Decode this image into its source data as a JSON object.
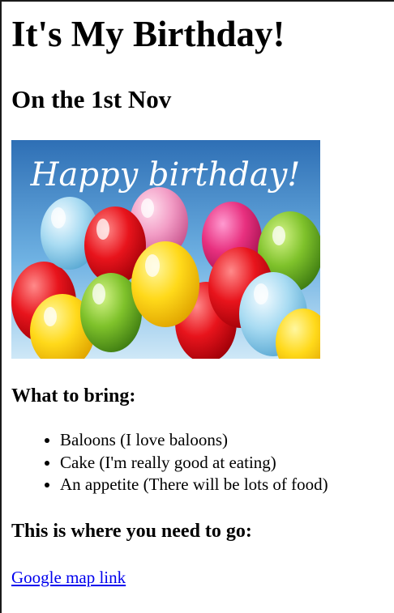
{
  "page": {
    "title": "It's My Birthday!",
    "date_heading": "On the 1st Nov",
    "banner": {
      "caption": "Happy birthday!",
      "colors": {
        "sky_top": "#2e6fb5",
        "sky_bottom": "#a9d4f0",
        "text": "#ffffff"
      }
    },
    "bring": {
      "heading": "What to bring:",
      "items": [
        "Baloons (I love baloons)",
        "Cake (I'm really good at eating)",
        "An appetite (There will be lots of food)"
      ]
    },
    "location": {
      "heading": "This is where you need to go:",
      "link_text": "Google map link"
    },
    "colors": {
      "link": "#0000ee",
      "text": "#000000"
    }
  }
}
